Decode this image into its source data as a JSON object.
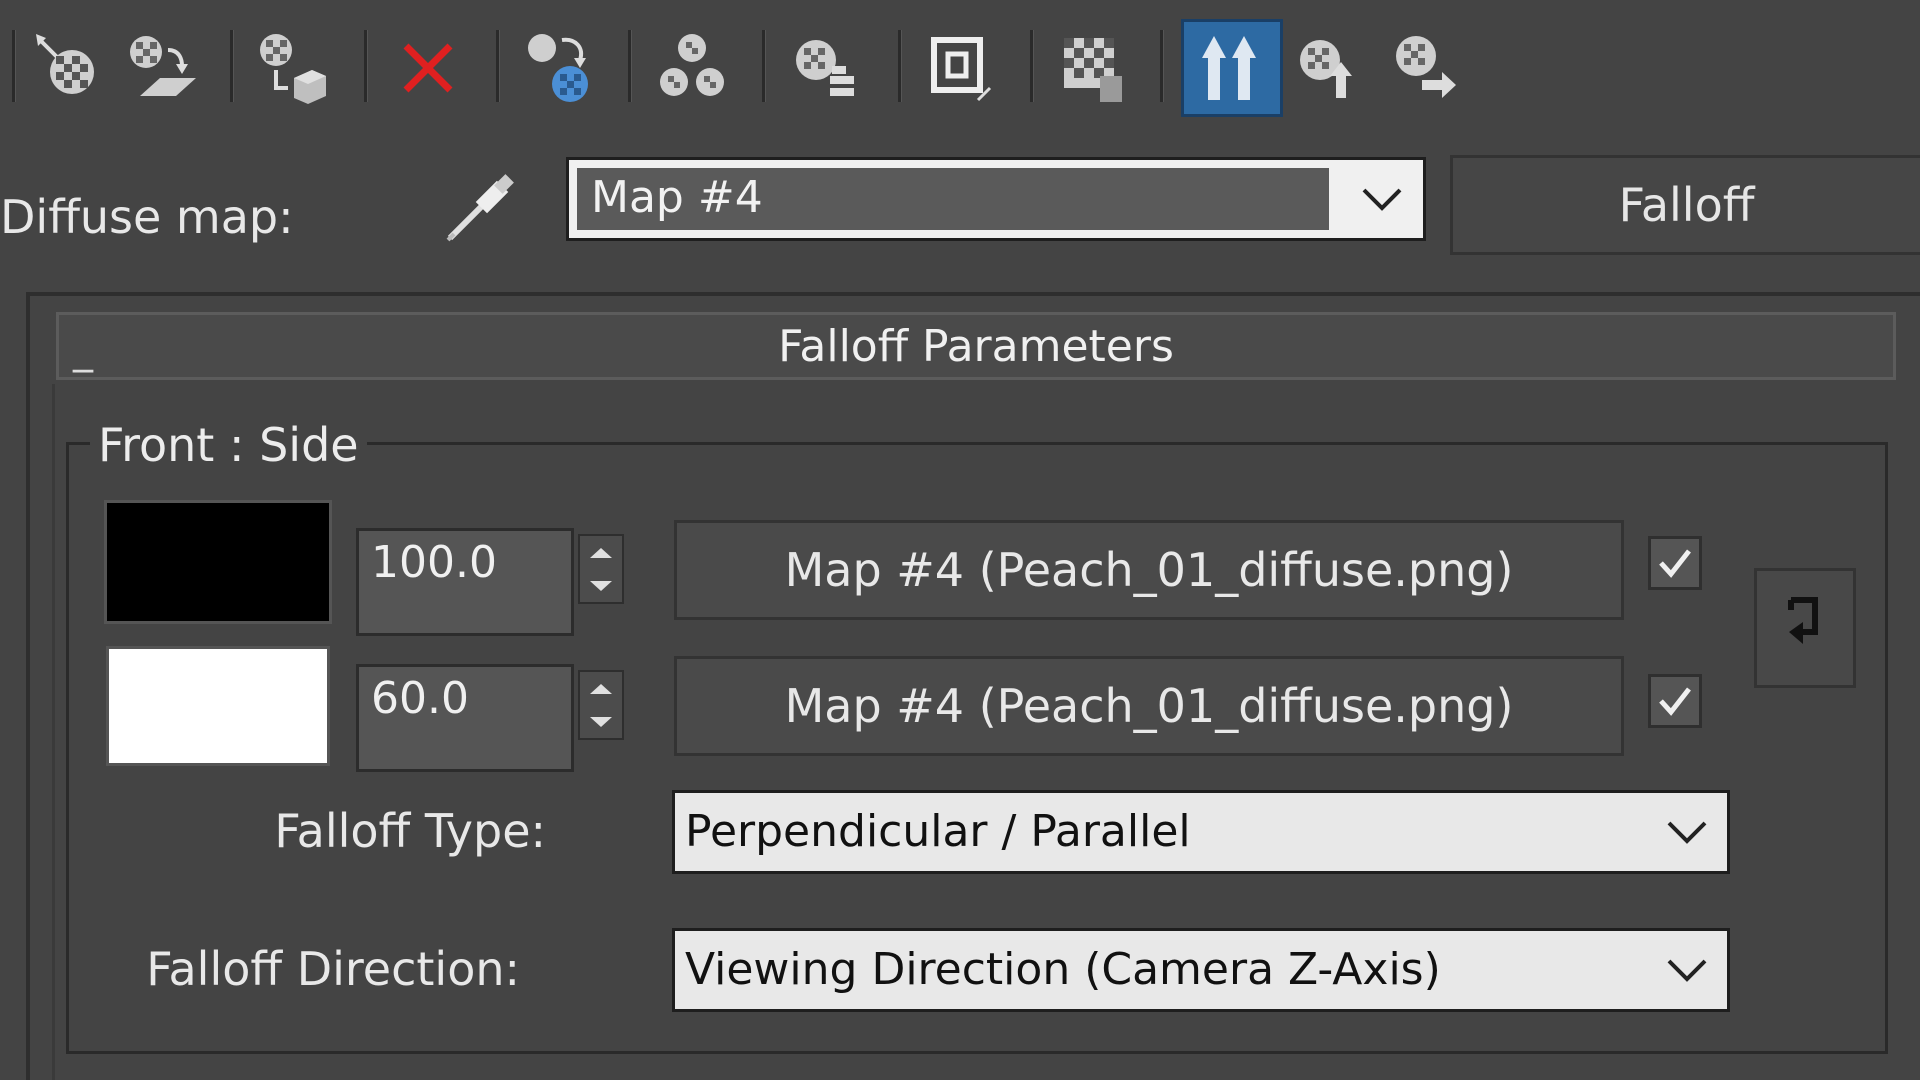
{
  "toolbar": {
    "buttons": [
      {
        "name": "get-material-icon"
      },
      {
        "name": "put-to-scene-icon"
      },
      {
        "name": "assign-to-selection-icon"
      },
      {
        "name": "delete-icon"
      },
      {
        "name": "make-unique-icon"
      },
      {
        "name": "put-to-library-icon"
      },
      {
        "name": "material-id-channel-icon"
      },
      {
        "name": "show-end-result-icon"
      },
      {
        "name": "show-shaded-material-icon"
      },
      {
        "name": "go-to-parent-icon",
        "active": true
      },
      {
        "name": "go-forward-sibling-icon"
      },
      {
        "name": "pick-material-icon"
      }
    ],
    "delete_color": "#e02020",
    "active_color": "#2d6aa3"
  },
  "diffuse": {
    "label": "Diffuse map:",
    "map_value": "Map #4",
    "type_label": "Falloff"
  },
  "rollout": {
    "title": "Falloff Parameters",
    "collapse_glyph": "_"
  },
  "front_side": {
    "group_title": "Front : Side",
    "rows": [
      {
        "color": "#000000",
        "value": "100.0",
        "map": "Map #4 (Peach_01_diffuse.png)",
        "checked": true
      },
      {
        "color": "#ffffff",
        "value": "60.0",
        "map": "Map #4 (Peach_01_diffuse.png)",
        "checked": true
      }
    ]
  },
  "falloff_type": {
    "label": "Falloff Type:",
    "value": "Perpendicular / Parallel"
  },
  "falloff_direction": {
    "label": "Falloff Direction:",
    "value": "Viewing Direction (Camera Z-Axis)"
  }
}
